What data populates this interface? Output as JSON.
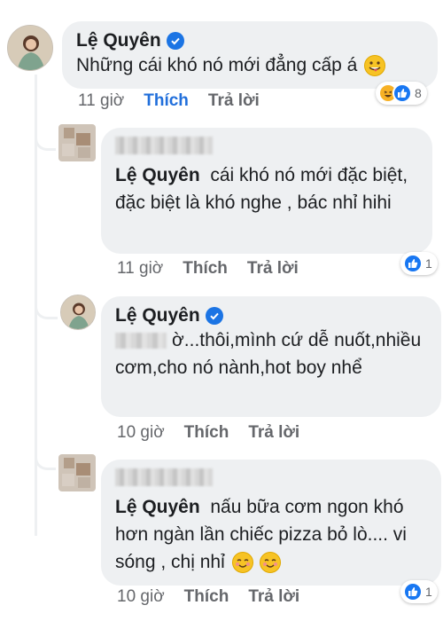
{
  "comments": [
    {
      "author": "Lệ Quyên",
      "verified": true,
      "text": "Những cái khó nó mới đẳng cấp á",
      "time": "11 giờ",
      "like_label": "Thích",
      "like_active": true,
      "reply_label": "Trả lời",
      "reaction_count": "8",
      "reaction_icons": [
        "haha-icon",
        "like-icon"
      ]
    },
    {
      "author_blurred": true,
      "mention": "Lệ Quyên",
      "text": "cái khó nó mới đặc biệt, đặc biệt là khó nghe , bác nhỉ hihi",
      "time": "11 giờ",
      "like_label": "Thích",
      "reply_label": "Trả lời",
      "reaction_count": "1"
    },
    {
      "author": "Lệ Quyên",
      "verified": true,
      "mention_blurred": true,
      "text": "ờ...thôi,mình cứ dễ nuốt,nhiều cơm,cho nó nành,hot boy nhể",
      "time": "10 giờ",
      "like_label": "Thích",
      "reply_label": "Trả lời"
    },
    {
      "author_blurred": true,
      "mention": "Lệ Quyên",
      "text": "nấu bữa cơm ngon khó hơn ngàn lần chiếc pizza bỏ lò.... vi sóng , chị nhỉ",
      "time": "10 giờ",
      "like_label": "Thích",
      "reply_label": "Trả lời",
      "reaction_count": "1"
    }
  ],
  "colors": {
    "bubble": "#eef0f2",
    "link_blue": "#216fdb",
    "meta_gray": "#65676b",
    "verified_blue": "#1b74e4"
  }
}
